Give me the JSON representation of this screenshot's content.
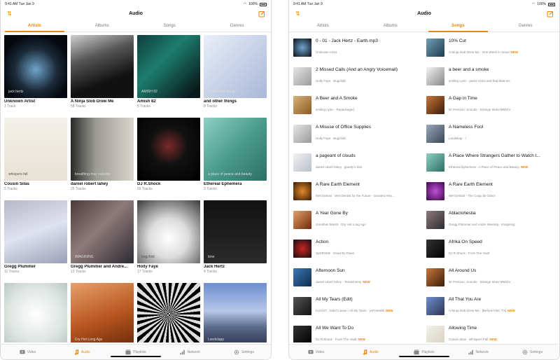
{
  "status": {
    "time": "9:41 AM",
    "date": "Tue Jan 9",
    "battery": "100%"
  },
  "left": {
    "title": "Audio",
    "tabs": [
      "Artists",
      "Albums",
      "Songs",
      "Genres"
    ],
    "active_tab": 0,
    "artists": [
      {
        "name": "Unknown Artist",
        "tracks": "1 Track",
        "caption": "jack hertz"
      },
      {
        "name": "A Ninja Slob Drew Me",
        "tracks": "58 Tracks",
        "caption": ""
      },
      {
        "name": "Amish 82",
        "tracks": "5 Tracks",
        "caption": "AMISH 82"
      },
      {
        "name": "and other things",
        "tracks": "8 Tracks",
        "caption": "...and other things"
      },
      {
        "name": "Cousin Silas",
        "tracks": "5 Tracks",
        "caption": "whispers fall"
      },
      {
        "name": "daniel robert lahey",
        "tracks": "25 Tracks",
        "caption": "breathing may subside"
      },
      {
        "name": "DJ R.Shock",
        "tracks": "59 Tracks",
        "caption": ""
      },
      {
        "name": "Ethereal Ephemera",
        "tracks": "3 Tracks",
        "caption": "a place of peace and beauty"
      },
      {
        "name": "Gregg Plummer",
        "tracks": "11 Tracks",
        "caption": ""
      },
      {
        "name": "Gregg Plummer and Andre...",
        "tracks": "13 Tracks",
        "caption": "IMAGINING"
      },
      {
        "name": "Holly Faye",
        "tracks": "17 Tracks",
        "caption": "bugchild"
      },
      {
        "name": "Jack Hertz",
        "tracks": "4 Tracks",
        "caption": "time"
      },
      {
        "name": "",
        "tracks": "",
        "caption": "hidden"
      },
      {
        "name": "",
        "tracks": "",
        "caption": "Dry Hot Long Ago"
      },
      {
        "name": "",
        "tracks": "",
        "caption": ""
      },
      {
        "name": "",
        "tracks": "",
        "caption": "Landslapp"
      }
    ]
  },
  "right": {
    "title": "Audio",
    "tabs": [
      "Artists",
      "Albums",
      "Songs",
      "Genres"
    ],
    "active_tab": 2,
    "songs_left": [
      {
        "title": "0 - 01 - Jack Hertz - Earth.mp3",
        "sub": "Unknown Artist",
        "new": ""
      },
      {
        "title": "2 Missed Calls (And an Angry Voicemail)",
        "sub": "Holly Faye · Bugchild",
        "new": ""
      },
      {
        "title": "A Beer and A Smoke",
        "sub": "smiling cynic · Repackaged",
        "new": ""
      },
      {
        "title": "A Misuse of Office Supplies",
        "sub": "Holly Faye · Bugchild",
        "new": ""
      },
      {
        "title": "a pageant of clouds",
        "sub": "daniel robert lahey · gravity's kiss",
        "new": ""
      },
      {
        "title": "A Rare Earth Element",
        "sub": "Wet Dentist · Wet Dentist for the Future - Greatest Hits...",
        "new": ""
      },
      {
        "title": "A Year Gone By",
        "sub": "Jonathan Marsh · Dry Hot Long Ago",
        "new": ""
      },
      {
        "title": "Action",
        "sub": "SpDRSHE · Dead By Dawn",
        "new": ""
      },
      {
        "title": "Afternoon Sun",
        "sub": "daniel robert lahey · Tenatchemy",
        "new": "NEW"
      },
      {
        "title": "All My Tears (Edit)",
        "sub": "KUGHT · Didn't Leave / All My Tears · ynFree005",
        "new": "NEW"
      },
      {
        "title": "All We Want To Do",
        "sub": "DJ R.Shock · From The Vault",
        "new": "NEW"
      }
    ],
    "songs_right": [
      {
        "title": "10% Cut",
        "sub": "A Ninja Slob Drew Me · One Week in Seoul",
        "new": "NEW"
      },
      {
        "title": "a beer and a smoke",
        "sub": "smiling cynic · parlor tricks and bad illusions",
        "new": ""
      },
      {
        "title": "A Gap in Time",
        "sub": "M. Persson: Sounds · Strange Skies MMXIV",
        "new": ""
      },
      {
        "title": "A Nameless Fool",
        "sub": "Landskap · I",
        "new": ""
      },
      {
        "title": "A Place Where Strangers Gather to Watch t...",
        "sub": "Ethereal Ephemera · A Place of Peace and Beauty",
        "new": "NEW"
      },
      {
        "title": "A Rare Earth Element",
        "sub": "Wet Dentist · The Coup de Grâce",
        "new": ""
      },
      {
        "title": "Ablaclohestia",
        "sub": "Gregg Plummer and Andre Weining · Imagining",
        "new": ""
      },
      {
        "title": "Afrika On Speed",
        "sub": "DJ R.Shock · From The Vault",
        "new": ""
      },
      {
        "title": "All Around Us",
        "sub": "M. Persson: Sounds · Strange Skies MMXIV",
        "new": ""
      },
      {
        "title": "All That You Are",
        "sub": "A Ninja Slob Drew Me · [Before/After, TX]",
        "new": "NEW"
      },
      {
        "title": "Allowing Time",
        "sub": "Cousin Silas · Whispers Fall",
        "new": "NEW"
      }
    ]
  },
  "tabbar": [
    {
      "label": "Video",
      "icon": "video-icon"
    },
    {
      "label": "Audio",
      "icon": "music-note-icon"
    },
    {
      "label": "Playlists",
      "icon": "playlist-icon"
    },
    {
      "label": "Network",
      "icon": "network-icon"
    },
    {
      "label": "Settings",
      "icon": "gear-icon"
    }
  ],
  "colors": {
    "accent": "#f08400",
    "new_badge": "#f08400"
  }
}
